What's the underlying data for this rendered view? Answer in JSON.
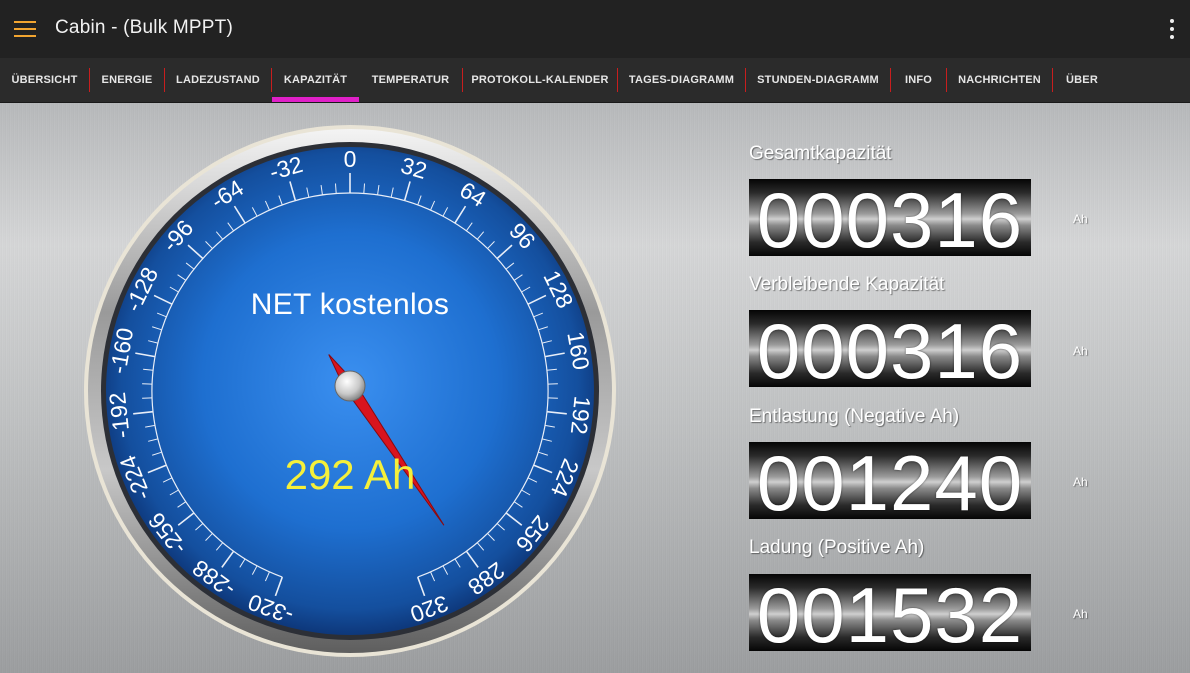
{
  "app": {
    "title": "Cabin - (Bulk MPPT)",
    "menu_icon": "hamburger-menu-icon",
    "overflow_icon": "more-vert-icon"
  },
  "tabs": [
    {
      "label": "ÜBERSICHT",
      "active": false
    },
    {
      "label": "ENERGIE",
      "active": false
    },
    {
      "label": "LADEZUSTAND",
      "active": false
    },
    {
      "label": "KAPAZITÄT",
      "active": true
    },
    {
      "label": "TEMPERATUR",
      "active": false
    },
    {
      "label": "PROTOKOLL-KALENDER",
      "active": false
    },
    {
      "label": "TAGES-DIAGRAMM",
      "active": false
    },
    {
      "label": "STUNDEN-DIAGRAMM",
      "active": false
    },
    {
      "label": "INFO",
      "active": false
    },
    {
      "label": "NACHRICHTEN",
      "active": false
    },
    {
      "label": "ÜBER",
      "active": false
    }
  ],
  "gauge": {
    "title": "NET kostenlos",
    "value_text": "292 Ah",
    "value": 292,
    "min": -320,
    "max": 320,
    "major_step": 32,
    "tick_labels": [
      "-320",
      "-288",
      "-256",
      "-224",
      "-192",
      "-160",
      "-128",
      "-96",
      "-64",
      "-32",
      "0",
      "32",
      "64",
      "96",
      "128",
      "160",
      "192",
      "224",
      "256",
      "288",
      "320"
    ],
    "colors": {
      "face": "#1e6fd0",
      "needle": "#d8141e",
      "value_text": "#f5f03a"
    }
  },
  "counters": [
    {
      "label": "Gesamtkapazität",
      "value": "000316",
      "unit": "Ah"
    },
    {
      "label": "Verbleibende Kapazität",
      "value": "000316",
      "unit": "Ah"
    },
    {
      "label": "Entlastung (Negative Ah)",
      "value": "001240",
      "unit": "Ah"
    },
    {
      "label": "Ladung (Positive Ah)",
      "value": "001532",
      "unit": "Ah"
    }
  ],
  "colors": {
    "appbar": "#222222",
    "tabbar": "#2b2b2b",
    "tab_separator": "#c81e1e",
    "tab_indicator": "#e020c8",
    "menu_icon": "#f2a530"
  }
}
